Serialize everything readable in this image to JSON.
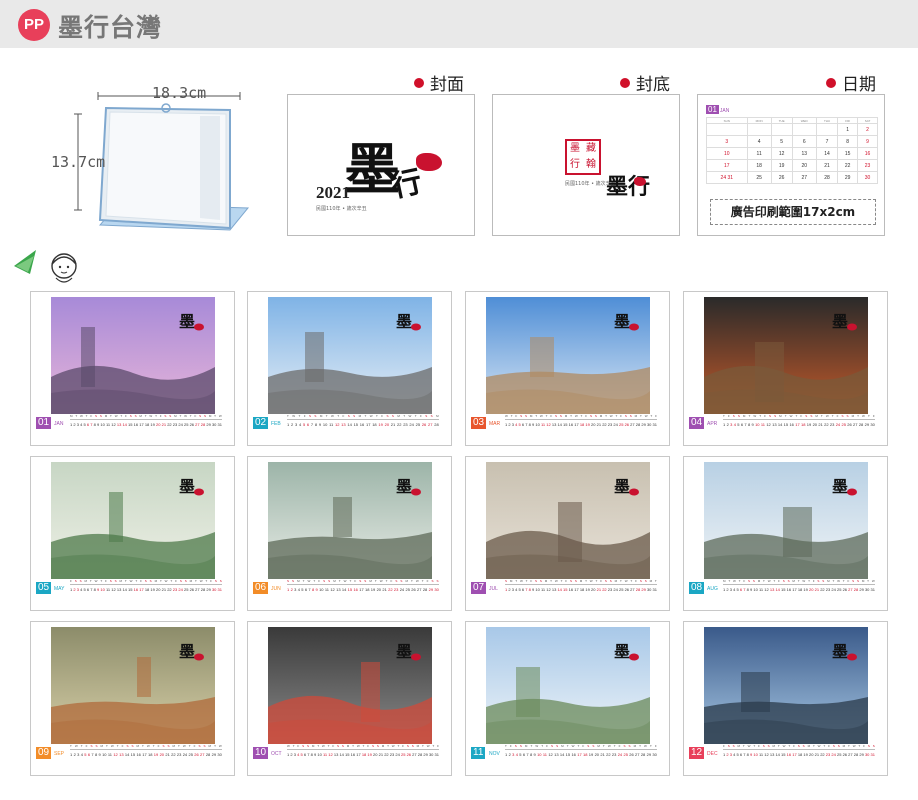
{
  "header": {
    "logo": "PP",
    "title": "墨行台灣"
  },
  "stand": {
    "width_label": "18.3cm",
    "height_label": "13.7cm"
  },
  "previews": {
    "cover": {
      "label": "封面",
      "brand": "墨",
      "brand2": "行",
      "year": "2021",
      "subtitle": "民國110年 • 歲次辛丑"
    },
    "back": {
      "label": "封底",
      "seal_chars": [
        "墨",
        "藏",
        "行",
        "翰"
      ],
      "subtitle": "民國110年 • 歲次辛丑",
      "brand": "墨行"
    },
    "date": {
      "label": "日期",
      "month_num": "01",
      "month_name": "JAN",
      "weekdays": [
        "SUN",
        "MON",
        "TUE",
        "WED",
        "THU",
        "FRI",
        "SAT"
      ],
      "weeks": [
        [
          "",
          "",
          "",
          "",
          "",
          "1",
          "2"
        ],
        [
          "3",
          "4",
          "5",
          "6",
          "7",
          "8",
          "9"
        ],
        [
          "10",
          "11",
          "12",
          "13",
          "14",
          "15",
          "16"
        ],
        [
          "17",
          "18",
          "19",
          "20",
          "21",
          "22",
          "23"
        ],
        [
          "24 31",
          "25",
          "26",
          "27",
          "28",
          "29",
          "30"
        ]
      ],
      "ad_text": "廣告印刷範圍17x2cm"
    }
  },
  "months": [
    {
      "num": "01",
      "name": "JAN",
      "color": "#9f4fb1",
      "days": 31
    },
    {
      "num": "02",
      "name": "FEB",
      "color": "#1ba7c4",
      "days": 28
    },
    {
      "num": "03",
      "name": "MAR",
      "color": "#e8562d",
      "days": 31
    },
    {
      "num": "04",
      "name": "APR",
      "color": "#9f4fb1",
      "days": 30
    },
    {
      "num": "05",
      "name": "MAY",
      "color": "#1ba7c4",
      "days": 31
    },
    {
      "num": "06",
      "name": "JUN",
      "color": "#f28c28",
      "days": 30
    },
    {
      "num": "07",
      "name": "JUL",
      "color": "#9f4fb1",
      "days": 31
    },
    {
      "num": "08",
      "name": "AUG",
      "color": "#1ba7c4",
      "days": 31
    },
    {
      "num": "09",
      "name": "SEP",
      "color": "#f28c28",
      "days": 30
    },
    {
      "num": "10",
      "name": "OCT",
      "color": "#9f4fb1",
      "days": 31
    },
    {
      "num": "11",
      "name": "NOV",
      "color": "#1ba7c4",
      "days": 30
    },
    {
      "num": "12",
      "name": "DEC",
      "color": "#e83f5a",
      "days": 31
    }
  ],
  "colors": {
    "accent": "#d0102a",
    "header_bg": "#e9e9e9",
    "stand_blue": "#9cc3e6",
    "mascot_green": "#3aa64b"
  }
}
